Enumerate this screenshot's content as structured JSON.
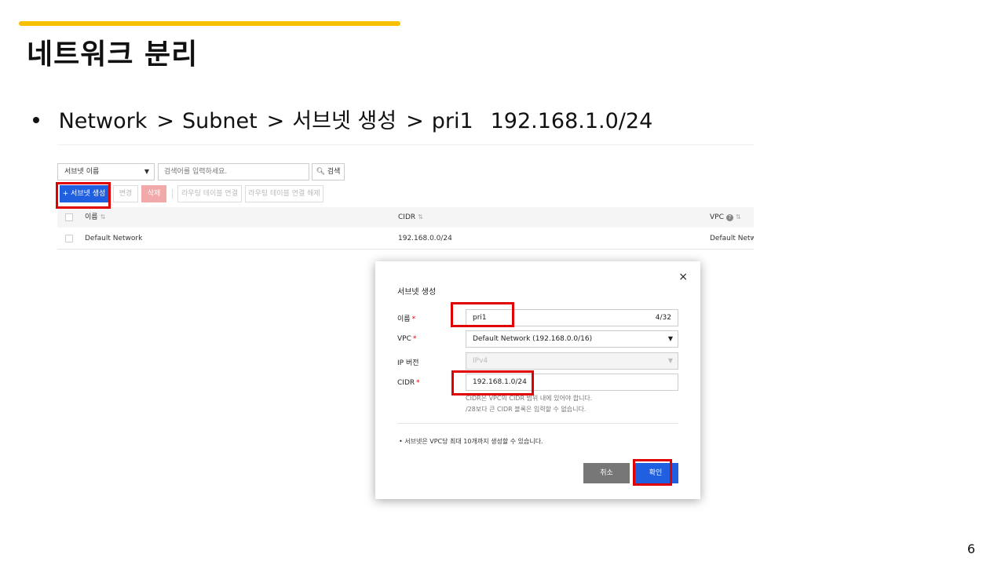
{
  "slide": {
    "title": "네트워크 분리",
    "bullet": {
      "path": [
        "Network",
        ">",
        "Subnet",
        ">",
        "서브넷 생성",
        ">",
        "pri1"
      ],
      "cidr": "192.168.1.0/24"
    },
    "page_number": "6"
  },
  "toolbar": {
    "search_select": "서브넷 이름",
    "search_placeholder": "검색어를 입력하세요.",
    "search_button": "검색",
    "create_button": "+ 서브넷 생성",
    "edit_button": "변경",
    "delete_button": "삭제",
    "route_link_button": "라우팅 테이블 연결",
    "route_unlink_button": "라우팅 테이블 연결 해제"
  },
  "table": {
    "columns": [
      "이름",
      "CIDR",
      "VPC"
    ],
    "rows": [
      {
        "name": "Default Network",
        "cidr": "192.168.0.0/24",
        "vpc": "Default Netwo"
      }
    ]
  },
  "modal": {
    "title": "서브넷 생성",
    "close": "×",
    "fields": {
      "name": {
        "label": "이름",
        "value": "pri1",
        "counter": "4/32"
      },
      "vpc": {
        "label": "VPC",
        "value": "Default Network (192.168.0.0/16)"
      },
      "ip_version": {
        "label": "IP 버전",
        "value": "IPv4"
      },
      "cidr": {
        "label": "CIDR",
        "value": "192.168.1.0/24"
      }
    },
    "cidr_help": [
      "CIDR은 VPC의 CIDR 범위 내에 있어야 합니다.",
      "/28보다 큰 CIDR 블록은 입력할 수 없습니다."
    ],
    "note": "•  서브넷은 VPC당 최대 10개까지 생성할 수 있습니다.",
    "cancel_button": "취소",
    "ok_button": "확인"
  },
  "colors": {
    "accent_bar": "#f6c000",
    "primary_button": "#1f5fe0",
    "highlight_box": "#e00000",
    "delete_button": "#f1a9a9"
  }
}
